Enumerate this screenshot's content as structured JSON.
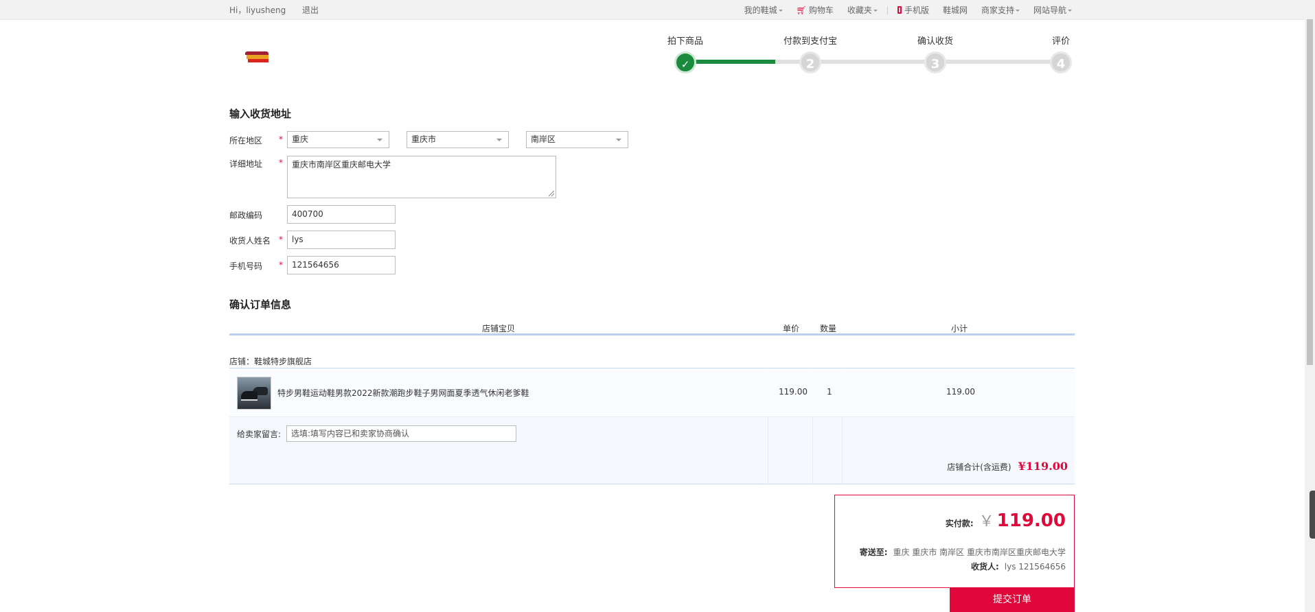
{
  "topbar": {
    "greeting": "Hi，liyusheng",
    "logout": "退出",
    "my_shoecity": "我的鞋城",
    "cart": "购物车",
    "favorites": "收藏夹",
    "mobile": "手机版",
    "shoe_net": "鞋城网",
    "merchant_support": "商家支持",
    "site_nav": "网站导航"
  },
  "steps": [
    {
      "label": "拍下商品",
      "number": "✓",
      "done": true
    },
    {
      "label": "付款到支付宝",
      "number": "2",
      "done": false
    },
    {
      "label": "确认收货",
      "number": "3",
      "done": false
    },
    {
      "label": "评价",
      "number": "4",
      "done": false
    }
  ],
  "address": {
    "title": "输入收货地址",
    "region_label": "所在地区",
    "province": "重庆",
    "city": "重庆市",
    "district": "南岸区",
    "detail_label": "详细地址",
    "detail_value": "重庆市南岸区重庆邮电大学",
    "postcode_label": "邮政编码",
    "postcode_value": "400700",
    "name_label": "收货人姓名",
    "name_value": "lys",
    "phone_label": "手机号码",
    "phone_value": "121564656",
    "required_mark": "*"
  },
  "order": {
    "title": "确认订单信息",
    "headers": {
      "item": "店铺宝贝",
      "price": "单价",
      "qty": "数量",
      "subtotal": "小计"
    },
    "shop_label": "店铺：",
    "shop_name": "鞋城特步旗舰店",
    "item_title": "特步男鞋运动鞋男款2022新款潮跑步鞋子男网面夏季透气休闲老爹鞋",
    "item_price": "119.00",
    "item_qty": "1",
    "item_subtotal": "119.00",
    "message_label": "给卖家留言:",
    "message_placeholder": "选填:填写内容已和卖家协商确认",
    "shop_total_label": "店铺合计(含运费)",
    "shop_total_value": "¥119.00"
  },
  "summary": {
    "pay_label": "实付款:",
    "currency": "￥",
    "pay_value": "119.00",
    "ship_to_label": "寄送至:",
    "ship_to_value": "重庆 重庆市 南岸区 重庆市南岸区重庆邮电大学",
    "receiver_label": "收货人:",
    "receiver_value": "lys 121564656",
    "submit": "提交订单"
  },
  "colors": {
    "accent": "#e0073a",
    "step_done": "#1a8a3c",
    "header_line": "#b9d0f0"
  }
}
